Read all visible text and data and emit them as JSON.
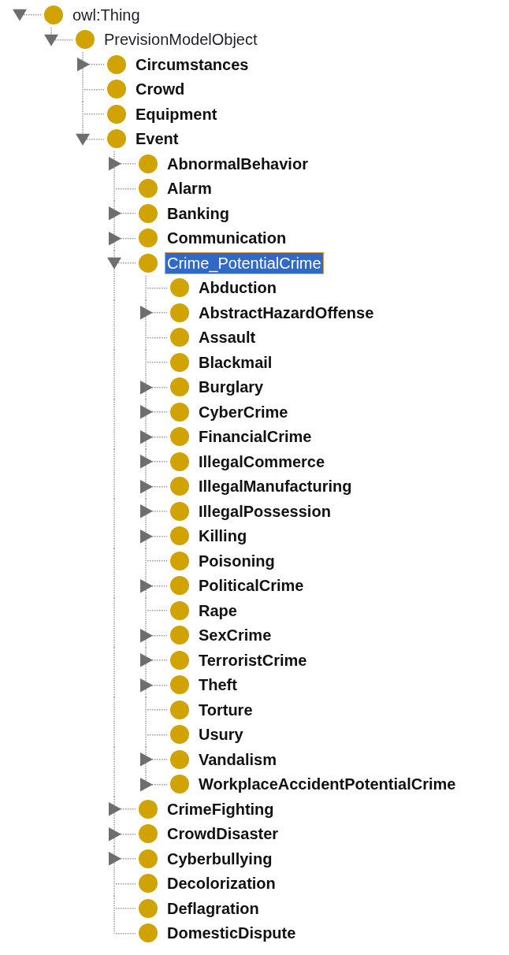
{
  "class_tree": [
    {
      "label": "owl:Thing",
      "bold": false,
      "selected": false,
      "kind": "branch",
      "expanded": true,
      "children": [
        {
          "label": "PrevisionModelObject",
          "bold": false,
          "selected": false,
          "kind": "branch",
          "expanded": true,
          "children": [
            {
              "label": "Circumstances",
              "bold": true,
              "selected": false,
              "kind": "branch",
              "expanded": false
            },
            {
              "label": "Crowd",
              "bold": true,
              "selected": false,
              "kind": "leaf"
            },
            {
              "label": "Equipment",
              "bold": true,
              "selected": false,
              "kind": "leaf"
            },
            {
              "label": "Event",
              "bold": true,
              "selected": false,
              "kind": "branch",
              "expanded": true,
              "children": [
                {
                  "label": "AbnormalBehavior",
                  "bold": true,
                  "selected": false,
                  "kind": "branch",
                  "expanded": false
                },
                {
                  "label": "Alarm",
                  "bold": true,
                  "selected": false,
                  "kind": "leaf"
                },
                {
                  "label": "Banking",
                  "bold": true,
                  "selected": false,
                  "kind": "branch",
                  "expanded": false
                },
                {
                  "label": "Communication",
                  "bold": true,
                  "selected": false,
                  "kind": "branch",
                  "expanded": false
                },
                {
                  "label": "Crime_PotentialCrime",
                  "bold": false,
                  "selected": true,
                  "kind": "branch",
                  "expanded": true,
                  "children": [
                    {
                      "label": "Abduction",
                      "bold": true,
                      "selected": false,
                      "kind": "leaf"
                    },
                    {
                      "label": "AbstractHazardOffense",
                      "bold": true,
                      "selected": false,
                      "kind": "branch",
                      "expanded": false
                    },
                    {
                      "label": "Assault",
                      "bold": true,
                      "selected": false,
                      "kind": "leaf"
                    },
                    {
                      "label": "Blackmail",
                      "bold": true,
                      "selected": false,
                      "kind": "leaf"
                    },
                    {
                      "label": "Burglary",
                      "bold": true,
                      "selected": false,
                      "kind": "branch",
                      "expanded": false
                    },
                    {
                      "label": "CyberCrime",
                      "bold": true,
                      "selected": false,
                      "kind": "branch",
                      "expanded": false
                    },
                    {
                      "label": "FinancialCrime",
                      "bold": true,
                      "selected": false,
                      "kind": "branch",
                      "expanded": false
                    },
                    {
                      "label": "IllegalCommerce",
                      "bold": true,
                      "selected": false,
                      "kind": "branch",
                      "expanded": false
                    },
                    {
                      "label": "IllegalManufacturing",
                      "bold": true,
                      "selected": false,
                      "kind": "branch",
                      "expanded": false
                    },
                    {
                      "label": "IllegalPossession",
                      "bold": true,
                      "selected": false,
                      "kind": "branch",
                      "expanded": false
                    },
                    {
                      "label": "Killing",
                      "bold": true,
                      "selected": false,
                      "kind": "branch",
                      "expanded": false
                    },
                    {
                      "label": "Poisoning",
                      "bold": true,
                      "selected": false,
                      "kind": "leaf"
                    },
                    {
                      "label": "PoliticalCrime",
                      "bold": true,
                      "selected": false,
                      "kind": "branch",
                      "expanded": false
                    },
                    {
                      "label": "Rape",
                      "bold": true,
                      "selected": false,
                      "kind": "leaf"
                    },
                    {
                      "label": "SexCrime",
                      "bold": true,
                      "selected": false,
                      "kind": "branch",
                      "expanded": false
                    },
                    {
                      "label": "TerroristCrime",
                      "bold": true,
                      "selected": false,
                      "kind": "branch",
                      "expanded": false
                    },
                    {
                      "label": "Theft",
                      "bold": true,
                      "selected": false,
                      "kind": "branch",
                      "expanded": false
                    },
                    {
                      "label": "Torture",
                      "bold": true,
                      "selected": false,
                      "kind": "leaf"
                    },
                    {
                      "label": "Usury",
                      "bold": true,
                      "selected": false,
                      "kind": "leaf"
                    },
                    {
                      "label": "Vandalism",
                      "bold": true,
                      "selected": false,
                      "kind": "branch",
                      "expanded": false
                    },
                    {
                      "label": "WorkplaceAccidentPotentialCrime",
                      "bold": true,
                      "selected": false,
                      "kind": "branch",
                      "expanded": false
                    }
                  ]
                },
                {
                  "label": "CrimeFighting",
                  "bold": true,
                  "selected": false,
                  "kind": "branch",
                  "expanded": false
                },
                {
                  "label": "CrowdDisaster",
                  "bold": true,
                  "selected": false,
                  "kind": "branch",
                  "expanded": false
                },
                {
                  "label": "Cyberbullying",
                  "bold": true,
                  "selected": false,
                  "kind": "branch",
                  "expanded": false
                },
                {
                  "label": "Decolorization",
                  "bold": true,
                  "selected": false,
                  "kind": "leaf"
                },
                {
                  "label": "Deflagration",
                  "bold": true,
                  "selected": false,
                  "kind": "leaf"
                },
                {
                  "label": "DomesticDispute",
                  "bold": true,
                  "selected": false,
                  "kind": "leaf"
                }
              ]
            }
          ]
        }
      ]
    }
  ]
}
